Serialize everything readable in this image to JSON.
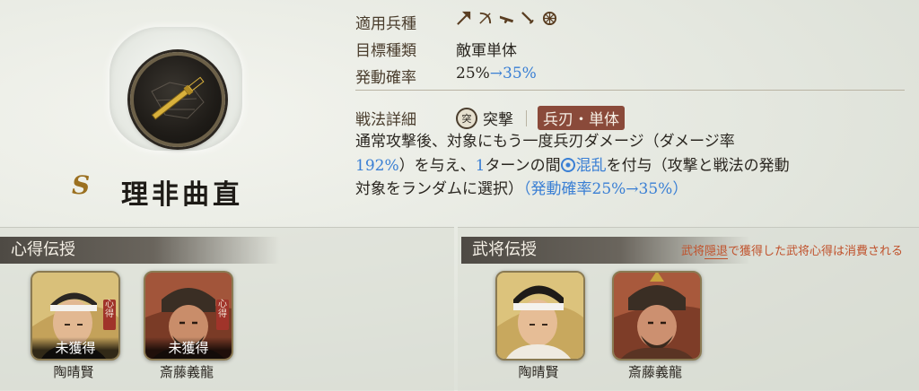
{
  "tactic": {
    "rank": "S",
    "name": "理非曲直",
    "icon": "sword-icon"
  },
  "info": {
    "applicable_label": "適用兵種",
    "weapons": [
      "spear-icon",
      "bow-icon",
      "gun-icon",
      "sword-icon",
      "cavalry-icon"
    ],
    "target_label": "目標種類",
    "target_value": "敵軍単体",
    "rate_label": "発動確率",
    "rate_base": "25%",
    "rate_upgrade": "→35%"
  },
  "detail": {
    "label": "戦法詳細",
    "type_icon": "突",
    "type_text": "突撃",
    "tag": "兵刃・単体",
    "line1": "通常攻撃後、対象にもう一度兵刃ダメージ（ダメージ率",
    "dmg_rate": "192%",
    "line2_a": "）を与え、",
    "turns": "1",
    "line2_b": "ターンの間",
    "status": "混乱",
    "line2_c": "を付与（攻撃と戦法の発動",
    "line3_a": "対象をランダムに選択）",
    "line3_b": "（発動確率25%→35%）"
  },
  "panels": {
    "inherit_title": "心得伝授",
    "general_title": "武将伝授",
    "notice_a": "武将",
    "notice_hl": "隠退",
    "notice_b": "で獲得した武将心得は消費される"
  },
  "inherit_cards": [
    {
      "name": "陶晴賢",
      "status": "未獲得",
      "seal": "心得"
    },
    {
      "name": "斎藤義龍",
      "status": "未獲得",
      "seal": "心得"
    }
  ],
  "general_cards": [
    {
      "name": "陶晴賢"
    },
    {
      "name": "斎藤義龍"
    }
  ],
  "colors": {
    "accent_blue": "#3a7fd4",
    "tag_red": "#8a4a3a",
    "notice_orange": "#c0522c",
    "rank_gold": "#9b7020"
  }
}
